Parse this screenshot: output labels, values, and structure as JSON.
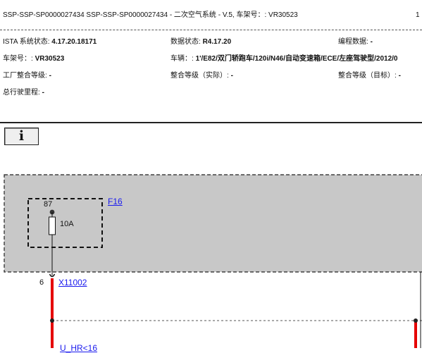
{
  "header": {
    "title": "SSP-SSP-SP0000027434 SSP-SSP-SP0000027434 - 二次空气系统 - V.5, 车架号：: VR30523",
    "page_marker": "1"
  },
  "info_rows": {
    "ista_label": "ISTA 系统状态:",
    "ista_value": "4.17.20.18171",
    "data_label": "数据状态:",
    "data_value": "R4.17.20",
    "prog_label": "编程数据:",
    "prog_value": "-",
    "vin_label": "车架号：:",
    "vin_value": "VR30523",
    "vehicle_label": "车辆：:",
    "vehicle_value": "1'/E82/双门轿跑车/120i/N46/自动变速箱/ECE/左座驾驶型/2012/0",
    "factory_label": "工厂整合等级:",
    "factory_value": "-",
    "actual_label": "整合等级（实际）:",
    "actual_value": "-",
    "target_label": "整合等级（目标）:",
    "target_value": "-",
    "mileage_label": "总行驶里程:",
    "mileage_value": "-"
  },
  "info_button": {
    "glyph": "i"
  },
  "diagram": {
    "fuse_id": "F16",
    "fuse_pin": "87",
    "fuse_rating": "10A",
    "connector_pin": "6",
    "connector_id": "X11002",
    "bottom_link": "U_HR<16"
  },
  "colors": {
    "wire_red": "#e50000",
    "panel_gray": "#c8c8c8",
    "link_blue": "#1a1aee"
  }
}
